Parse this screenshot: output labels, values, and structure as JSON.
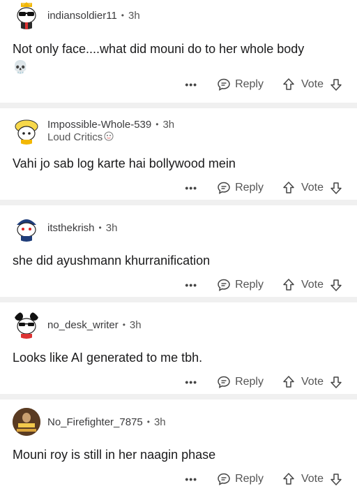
{
  "comments": [
    {
      "username": "indiansoldier11",
      "time": "3h",
      "flair": "",
      "text": "Not only face....what did mouni do to her whole body",
      "emoji": "💀",
      "reply_label": "Reply",
      "vote_label": "Vote",
      "more_label": "•••",
      "avatar_color": "#fff4d6"
    },
    {
      "username": "Impossible-Whole-539",
      "time": "3h",
      "flair": "Loud Critics",
      "text": "Vahi jo sab log karte hai bollywood mein",
      "emoji": "",
      "reply_label": "Reply",
      "vote_label": "Vote",
      "more_label": "•••",
      "avatar_color": "#fff3c4"
    },
    {
      "username": "itsthekrish",
      "time": "3h",
      "flair": "",
      "text": "she did ayushmann khurranification",
      "emoji": "",
      "reply_label": "Reply",
      "vote_label": "Vote",
      "more_label": "•••",
      "avatar_color": "#e6eef8"
    },
    {
      "username": "no_desk_writer",
      "time": "3h",
      "flair": "",
      "text": "Looks like AI generated to me tbh.",
      "emoji": "",
      "reply_label": "Reply",
      "vote_label": "Vote",
      "more_label": "•••",
      "avatar_color": "#f4f4f4"
    },
    {
      "username": "No_Firefighter_7875",
      "time": "3h",
      "flair": "",
      "text": "Mouni roy is still in her naagin phase",
      "emoji": "",
      "reply_label": "Reply",
      "vote_label": "Vote",
      "more_label": "•••",
      "avatar_color": "#6b4a2a"
    }
  ],
  "colors": {
    "separator": "#f0f0f0",
    "meta_text": "#555555",
    "body_text": "#1a1a1b"
  },
  "icons": {
    "avatar_0": "snoo-sunglasses-crown-icon",
    "avatar_1": "snoo-yellow-hat-icon",
    "avatar_2": "snoo-blue-cap-icon",
    "avatar_3": "snoo-mouse-ears-icon",
    "avatar_4": "movie-poster-avatar-icon",
    "reply": "comment-bubble-icon",
    "upvote": "arrow-up-icon",
    "downvote": "arrow-down-icon"
  }
}
